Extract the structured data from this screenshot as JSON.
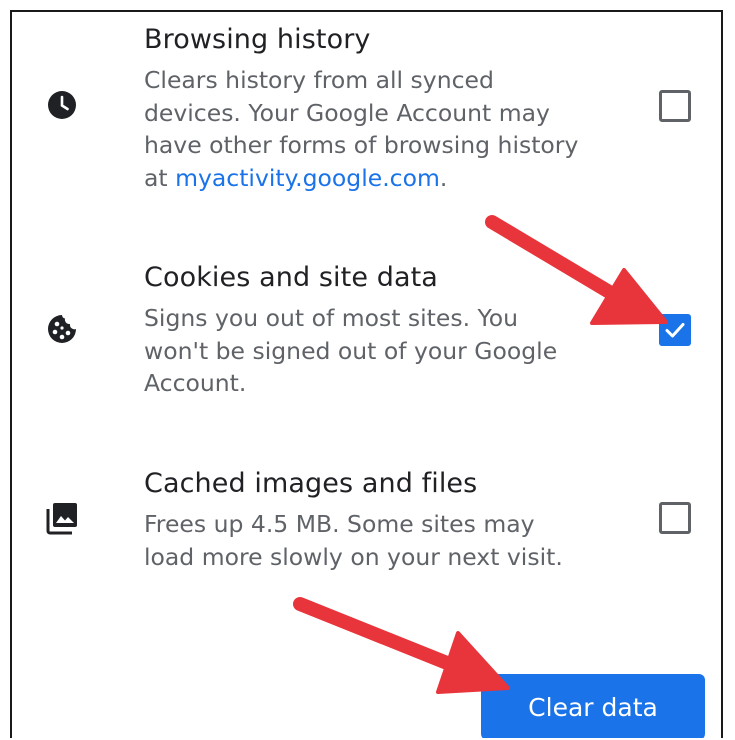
{
  "options": [
    {
      "title": "Browsing history",
      "desc_lines": [
        "Clears history from all synced",
        "devices. Your Google Account may",
        "have other forms of browsing history"
      ],
      "desc_prefix": "at ",
      "link_text": "myactivity.google.com",
      "desc_suffix": ".",
      "icon": "clock-icon",
      "checked": false
    },
    {
      "title": "Cookies and site data",
      "desc_lines": [
        "Signs you out of most sites. You",
        "won't be signed out of your Google",
        "Account."
      ],
      "icon": "cookie-icon",
      "checked": true
    },
    {
      "title": "Cached images and files",
      "desc_lines": [
        "Frees up 4.5 MB. Some sites may",
        "load more slowly on your next visit."
      ],
      "icon": "image-stack-icon",
      "checked": false
    }
  ],
  "clear_button_label": "Clear data",
  "colors": {
    "accent": "#1a73e8",
    "annotation_arrow": "#e8343b",
    "title_text": "#202124",
    "secondary_text": "#5f6368"
  }
}
